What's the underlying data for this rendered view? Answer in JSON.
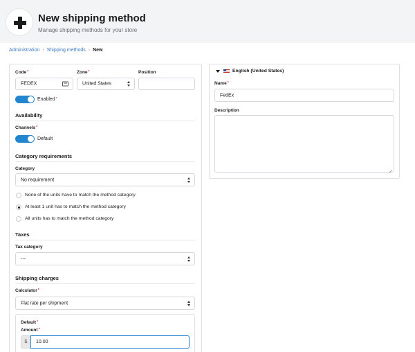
{
  "header": {
    "title": "New shipping method",
    "subtitle": "Manage shipping methods for your store"
  },
  "breadcrumb": {
    "items": [
      "Administration",
      "Shipping methods",
      "New"
    ]
  },
  "form": {
    "code": {
      "label": "Code",
      "value": "FEDEX"
    },
    "zone": {
      "label": "Zone",
      "value": "United States"
    },
    "position": {
      "label": "Position",
      "value": ""
    },
    "enabled": {
      "label": "Enabled",
      "on": true
    },
    "availability": {
      "title": "Availability",
      "channels_label": "Channels",
      "default_label": "Default",
      "default_on": true
    },
    "category_requirements": {
      "title": "Category requirements",
      "category_label": "Category",
      "category_value": "No requirement",
      "options": [
        "None of the units have to match the method category",
        "At least 1 unit has to match the method category",
        "All units has to match the method category"
      ],
      "selected_index": 1
    },
    "taxes": {
      "title": "Taxes",
      "tax_category_label": "Tax category",
      "tax_category_value": "---"
    },
    "shipping_charges": {
      "title": "Shipping charges",
      "calculator_label": "Calculator",
      "calculator_value": "Flat rate per shipment",
      "default_label": "Default",
      "amount_label": "Amount",
      "currency": "$",
      "amount_value": "10.00"
    }
  },
  "translation": {
    "locale": "English (United States)",
    "name_label": "Name",
    "name_value": "FedEx",
    "description_label": "Description",
    "description_value": ""
  },
  "colors": {
    "accent": "#2185d0",
    "link": "#3b79c4",
    "required": "#d01919",
    "header_bg": "#f3f4f6"
  },
  "icons": {
    "header": "plus-icon",
    "code_field": "card-icon",
    "select": "updown-caret-icon",
    "locale_toggle": "caret-down-icon",
    "locale_flag": "us-flag-icon",
    "textarea": "resize-handle-icon"
  }
}
